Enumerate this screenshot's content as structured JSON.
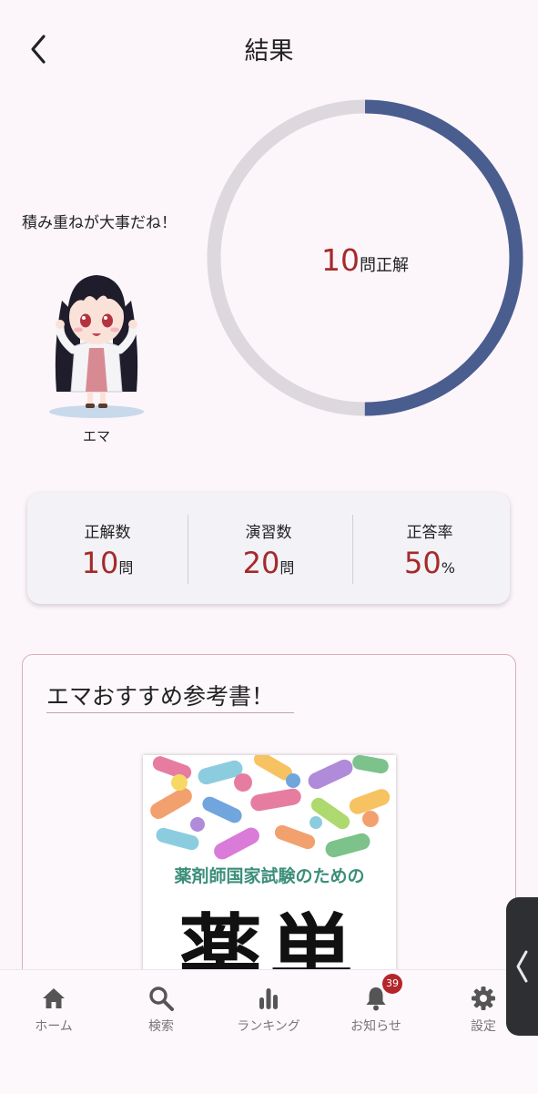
{
  "header": {
    "title": "結果",
    "back_icon": "chevron-left-icon"
  },
  "character": {
    "speech": "積み重ねが大事だね！",
    "name": "エマ"
  },
  "result": {
    "correct_count": "10",
    "correct_suffix": "問正解",
    "correct_fraction": 0.5,
    "ring_color": "#4a5d8f",
    "ring_track_color": "#dcd8dd"
  },
  "stats": [
    {
      "label": "正解数",
      "value": "10",
      "unit": "問"
    },
    {
      "label": "演習数",
      "value": "20",
      "unit": "問"
    },
    {
      "label": "正答率",
      "value": "50",
      "unit": "%"
    }
  ],
  "recommendation": {
    "title": "エマおすすめ参考書！",
    "book": {
      "subtitle": "薬剤師国家試験のための",
      "title": "薬単"
    }
  },
  "tabbar": {
    "items": [
      {
        "label": "ホーム",
        "icon": "home-icon"
      },
      {
        "label": "検索",
        "icon": "search-icon"
      },
      {
        "label": "ランキング",
        "icon": "bar-chart-icon"
      },
      {
        "label": "お知らせ",
        "icon": "bell-icon",
        "badge": "39"
      },
      {
        "label": "設定",
        "icon": "gear-icon"
      }
    ]
  },
  "colors": {
    "accent_red": "#a52a2a",
    "tab_icon": "#555555",
    "badge": "#b3262b"
  }
}
